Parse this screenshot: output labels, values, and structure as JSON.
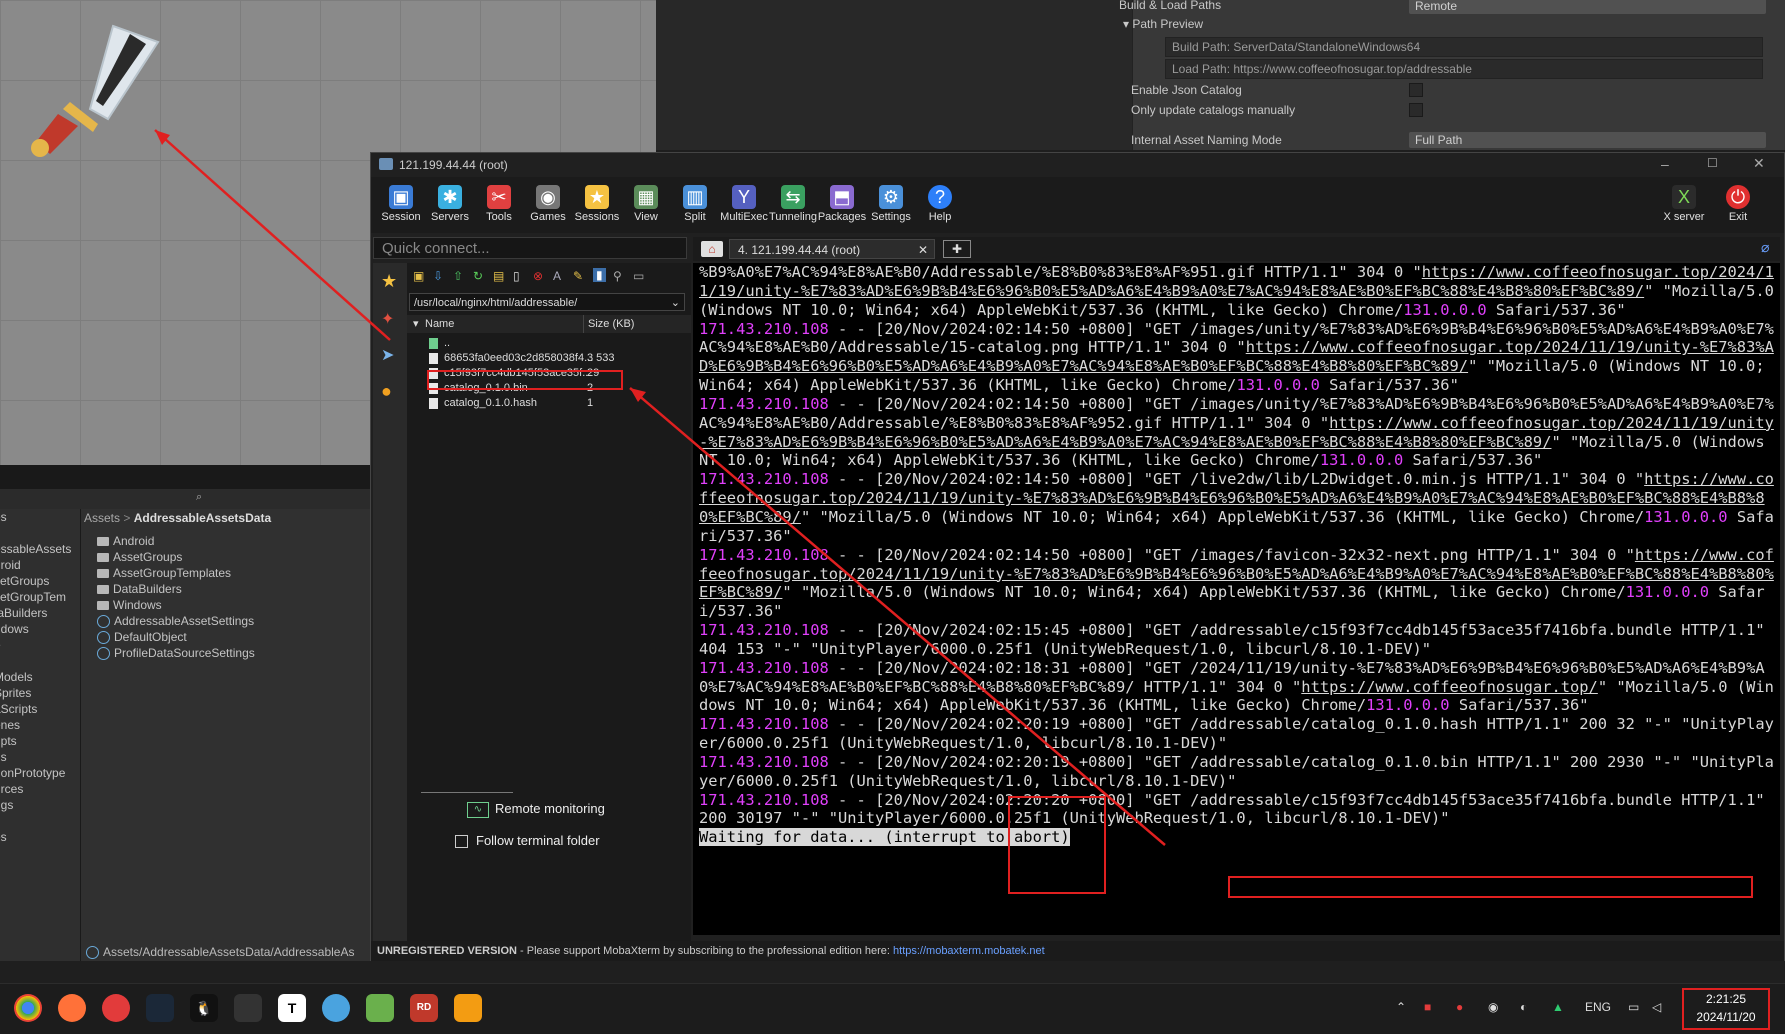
{
  "inspector": {
    "row_build_load": "Build & Load Paths",
    "row_build_load_value": "Remote",
    "path_preview": "Path Preview",
    "build_path": "Build Path: ServerData/StandaloneWindows64",
    "load_path": "Load Path: https://www.coffeeofnosugar.top/addressable",
    "enable_json": "Enable Json Catalog",
    "only_update": "Only update catalogs manually",
    "naming_mode": "Internal Asset Naming Mode",
    "naming_mode_value": "Full Path"
  },
  "project": {
    "breadcrumb_root": "Assets",
    "breadcrumb_sep": ">",
    "breadcrumb_leaf": "AddressableAssetsData",
    "left_items": [
      "es",
      "",
      "essableAssets",
      "droid",
      "setGroups",
      "setGroupTem",
      "taBuilders",
      "ndows",
      "e",
      "t",
      "Models",
      "Sprites",
      "aScripts",
      "enes",
      "ripts",
      "ns",
      "gonPrototype",
      "urces",
      "ngs",
      "",
      "es"
    ],
    "items": [
      {
        "label": "Android",
        "kind": "folder"
      },
      {
        "label": "AssetGroups",
        "kind": "folder"
      },
      {
        "label": "AssetGroupTemplates",
        "kind": "folder"
      },
      {
        "label": "DataBuilders",
        "kind": "folder"
      },
      {
        "label": "Windows",
        "kind": "folder"
      },
      {
        "label": "AddressableAssetSettings",
        "kind": "asset"
      },
      {
        "label": "DefaultObject",
        "kind": "asset"
      },
      {
        "label": "ProfileDataSourceSettings",
        "kind": "asset"
      }
    ],
    "footer_path": "Assets/AddressableAssetsData/AddressableAs"
  },
  "moba": {
    "title": "121.199.44.44 (root)",
    "toolbar": [
      "Session",
      "Servers",
      "Tools",
      "Games",
      "Sessions",
      "View",
      "Split",
      "MultiExec",
      "Tunneling",
      "Packages",
      "Settings",
      "Help"
    ],
    "toolbar_right": [
      "X server",
      "Exit"
    ],
    "quick_connect": "Quick connect...",
    "tab_label": "4. 121.199.44.44 (root)",
    "sftp_path": "/usr/local/nginx/html/addressable/",
    "col_name": "Name",
    "col_size": "Size (KB)",
    "files": [
      {
        "name": "..",
        "size": ""
      },
      {
        "name": "68653fa0eed03c2d858038f4...",
        "size": "3 533"
      },
      {
        "name": "c15f93f7cc4db145f53ace35f...",
        "size": "29"
      },
      {
        "name": "catalog_0.1.0.bin",
        "size": "2"
      },
      {
        "name": "catalog_0.1.0.hash",
        "size": "1"
      }
    ],
    "remote_monitoring": "Remote monitoring",
    "follow_folder": "Follow terminal folder",
    "status_unregistered": "UNREGISTERED VERSION",
    "status_text": " -  Please support MobaXterm by subscribing to the professional edition here: ",
    "status_link": "https://mobaxterm.mobatek.net"
  },
  "terminal": {
    "wait_line": "Waiting for data... (interrupt to abort)"
  },
  "taskbar": {
    "lang": "ENG",
    "time": "2:21:25",
    "date": "2024/11/20"
  }
}
